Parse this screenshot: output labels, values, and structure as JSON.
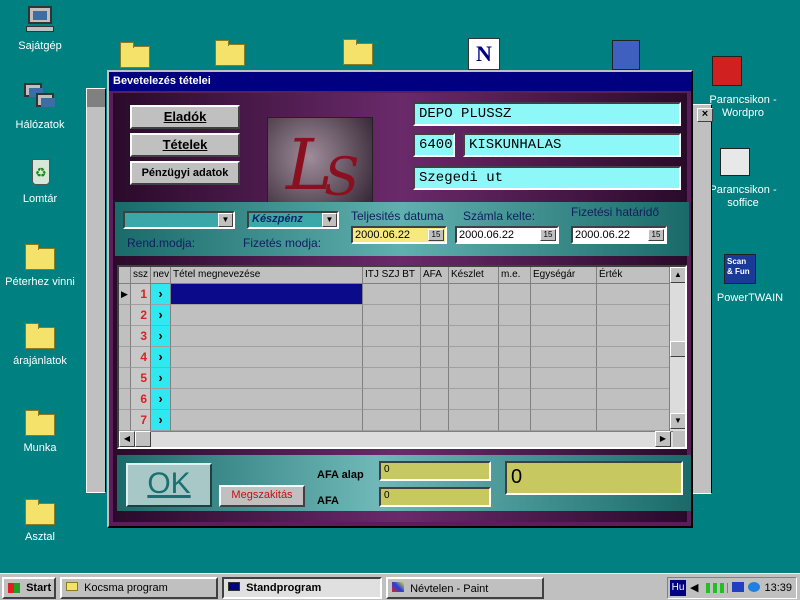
{
  "desktop": {
    "icons": [
      {
        "label": "Sajátgép"
      },
      {
        "label": "Hálózatok"
      },
      {
        "label": "Lomtár"
      },
      {
        "label": "Péterhez vinni"
      },
      {
        "label": "árajánlatok"
      },
      {
        "label": "Munka"
      },
      {
        "label": "Asztal"
      }
    ],
    "right_icons": [
      {
        "label": "Parancsikon - Wordpro"
      },
      {
        "label": "Parancsikon - soffice"
      },
      {
        "label": "PowerTWAIN"
      }
    ],
    "scan_icon_text": "Scan & Fun",
    "netscape_letter": "N"
  },
  "window": {
    "title": "Bevetelezés tételei",
    "close_symbol": "×",
    "buttons": {
      "eladok": "Eladók",
      "tetelek": "Tételek",
      "penzugyi": "Pénzügyi adatok"
    },
    "partner": {
      "name": "DEPO  PLUSSZ",
      "zip": "6400",
      "city": "KISKUNHALAS",
      "street": "Szegedi ut"
    },
    "order": {
      "rend_modja_label": "Rend.modja:",
      "rend_modja_value": "",
      "fizetes_modja_label": "Fizetés modja:",
      "fizetes_modja_value": "Készpénz",
      "teljesites_label": "Teljesités datuma",
      "teljesites_value": "2000.06.22",
      "szamla_label": "Számla kelte:",
      "szamla_value": "2000.06.22",
      "hatarido_label": "Fizetési határidő",
      "hatarido_value": "2000.06.22",
      "calendar_glyph": "15"
    },
    "grid": {
      "columns": [
        "ssz",
        "nev",
        "Tétel megnevezése",
        "ITJ SZJ BT",
        "AFA",
        "Készlet",
        "m.e.",
        "Egységár",
        "Érték"
      ],
      "rows": [
        "1",
        "2",
        "3",
        "4",
        "5",
        "6",
        "7"
      ],
      "row_marker": "▶",
      "nev_marker": "›"
    },
    "bottom": {
      "ok_label": "OK",
      "megszakitas_label": "Megszakitás",
      "afa_alap_label": "AFA alap",
      "afa_alap_value": "0",
      "afa_label": "AFA",
      "afa_value": "0",
      "total_value": "0"
    }
  },
  "taskbar": {
    "start_label": "Start",
    "buttons": [
      {
        "label": "Kocsma program"
      },
      {
        "label": "Standprogram"
      },
      {
        "label": "Névtelen - Paint"
      }
    ],
    "language": "Hu",
    "clock": "13:39"
  },
  "colors": {
    "desktop": "#008080",
    "title_bar": "#000080",
    "cyan_field": "#8ef8f8",
    "grid_selected": "#0a0a8a",
    "row_number": "#e02020"
  }
}
